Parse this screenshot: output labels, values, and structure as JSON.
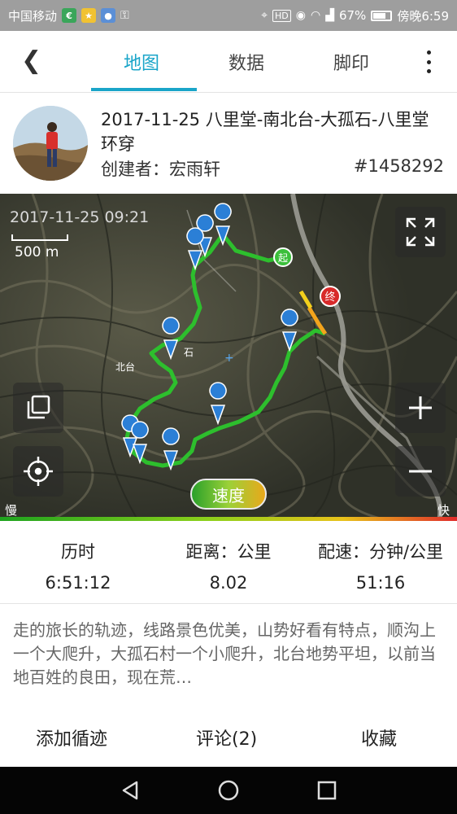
{
  "status_bar": {
    "carrier": "中国移动",
    "battery": "67%",
    "time": "傍晚6:59",
    "icons": [
      "wallet-icon",
      "star-icon",
      "app-icon",
      "key-icon",
      "location-icon",
      "hd-icon",
      "eye-icon",
      "wifi-icon",
      "signal-icon",
      "battery-icon"
    ]
  },
  "header": {
    "tabs": [
      {
        "label": "地图",
        "active": true
      },
      {
        "label": "数据",
        "active": false
      },
      {
        "label": "脚印",
        "active": false
      }
    ],
    "accent": "#1aa5c9"
  },
  "trail": {
    "title": "2017-11-25 八里堂-南北台-大孤石-八里堂环穿",
    "creator": "创建者：宏雨轩",
    "id": "#1458292"
  },
  "map": {
    "timestamp": "2017-11-25 09:21",
    "scale": "500 m",
    "start_marker": "起",
    "end_marker": "终",
    "place_labels": [
      "北台",
      "石"
    ],
    "speed_button": "速度",
    "slow_label": "慢",
    "fast_label": "快",
    "controls": [
      "fullscreen-icon",
      "layers-icon",
      "locate-icon",
      "zoom-in-icon",
      "zoom-out-icon"
    ]
  },
  "stats": [
    {
      "label": "历时",
      "value": "6:51:12"
    },
    {
      "label": "距离：公里",
      "value": "8.02"
    },
    {
      "label": "配速：分钟/公里",
      "value": "51:16"
    }
  ],
  "description": "走的旅长的轨迹，线路景色优美，山势好看有特点，顺沟上一个大爬升，大孤石村一个小爬升，北台地势平坦，以前当地百姓的良田，现在荒…",
  "actions": {
    "add": "添加循迹",
    "comment": "评论(2)",
    "favorite": "收藏"
  }
}
